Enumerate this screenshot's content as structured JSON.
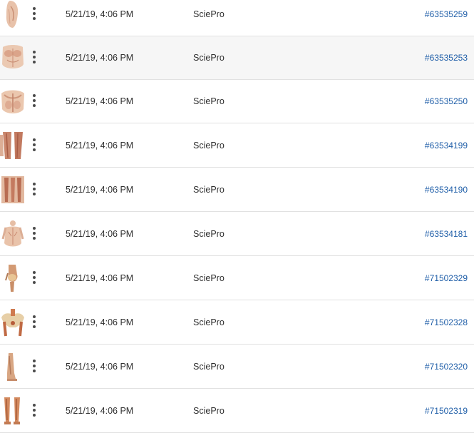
{
  "rows": [
    {
      "date": "5/21/19, 4:06 PM",
      "source": "SciePro",
      "id": "#63535259",
      "thumb": "torso-side-icon"
    },
    {
      "date": "5/21/19, 4:06 PM",
      "source": "SciePro",
      "id": "#63535253",
      "thumb": "torso-front-icon"
    },
    {
      "date": "5/21/19, 4:06 PM",
      "source": "SciePro",
      "id": "#63535250",
      "thumb": "back-muscles-icon"
    },
    {
      "date": "5/21/19, 4:06 PM",
      "source": "SciePro",
      "id": "#63534199",
      "thumb": "thigh-muscles-icon"
    },
    {
      "date": "5/21/19, 4:06 PM",
      "source": "SciePro",
      "id": "#63534190",
      "thumb": "leg-muscles-icon"
    },
    {
      "date": "5/21/19, 4:06 PM",
      "source": "SciePro",
      "id": "#63534181",
      "thumb": "upper-body-icon"
    },
    {
      "date": "5/21/19, 4:06 PM",
      "source": "SciePro",
      "id": "#71502329",
      "thumb": "knee-joint-icon"
    },
    {
      "date": "5/21/19, 4:06 PM",
      "source": "SciePro",
      "id": "#71502328",
      "thumb": "pelvis-icon"
    },
    {
      "date": "5/21/19, 4:06 PM",
      "source": "SciePro",
      "id": "#71502320",
      "thumb": "lower-leg-icon"
    },
    {
      "date": "5/21/19, 4:06 PM",
      "source": "SciePro",
      "id": "#71502319",
      "thumb": "legs-pair-icon"
    }
  ],
  "colors": {
    "link": "#1f5ea8",
    "text": "#2f2f2f",
    "divider": "#e1e1e1",
    "highlight": "#f6f6f6"
  }
}
